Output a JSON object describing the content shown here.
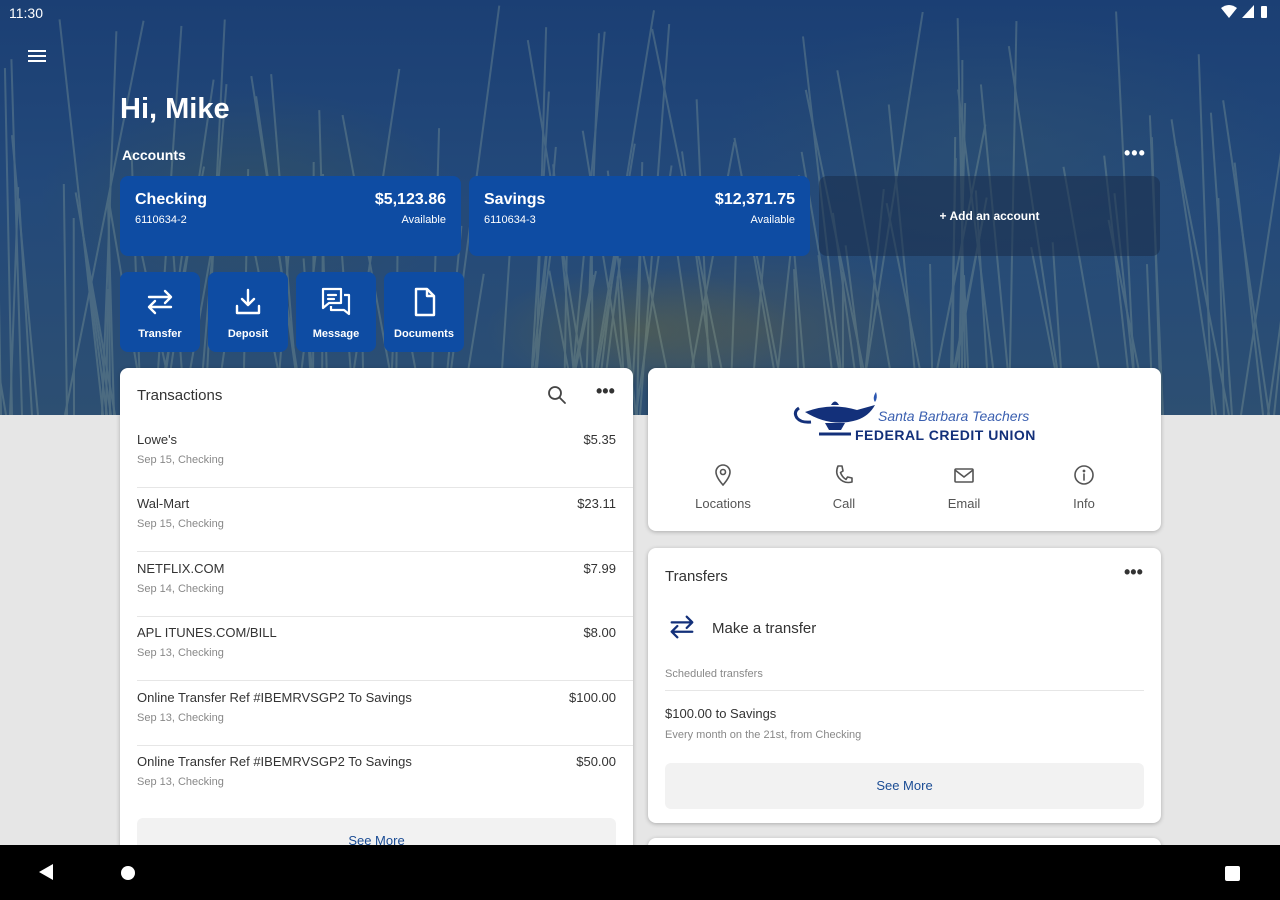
{
  "status_bar": {
    "time": "11:30"
  },
  "header": {
    "greeting": "Hi, Mike",
    "accounts_label": "Accounts",
    "more_label": "•••"
  },
  "accounts": [
    {
      "name": "Checking",
      "number": "6110634-2",
      "balance": "$5,123.86",
      "balance_label": "Available"
    },
    {
      "name": "Savings",
      "number": "6110634-3",
      "balance": "$12,371.75",
      "balance_label": "Available"
    }
  ],
  "add_account_label": "+ Add an account",
  "quick_actions": [
    {
      "label": "Transfer",
      "icon": "transfer-icon"
    },
    {
      "label": "Deposit",
      "icon": "deposit-icon"
    },
    {
      "label": "Message",
      "icon": "message-icon"
    },
    {
      "label": "Documents",
      "icon": "document-icon"
    }
  ],
  "transactions": {
    "title": "Transactions",
    "more_label": "•••",
    "items": [
      {
        "merchant": "Lowe's",
        "detail": "Sep 15, Checking",
        "amount": "$5.35"
      },
      {
        "merchant": "Wal-Mart",
        "detail": "Sep 15, Checking",
        "amount": "$23.11"
      },
      {
        "merchant": "NETFLIX.COM",
        "detail": "Sep 14, Checking",
        "amount": "$7.99"
      },
      {
        "merchant": "APL ITUNES.COM/BILL",
        "detail": "Sep 13, Checking",
        "amount": "$8.00"
      },
      {
        "merchant": "Online Transfer Ref #IBEMRVSGP2 To Savings",
        "detail": "Sep 13, Checking",
        "amount": "$100.00"
      },
      {
        "merchant": "Online Transfer Ref #IBEMRVSGP2 To Savings",
        "detail": "Sep 13, Checking",
        "amount": "$50.00"
      }
    ],
    "see_more": "See More"
  },
  "credit_union": {
    "name_script": "Santa Barbara Teachers",
    "name_bold": "FEDERAL CREDIT UNION",
    "contacts": [
      {
        "label": "Locations",
        "icon": "location-pin-icon"
      },
      {
        "label": "Call",
        "icon": "phone-icon"
      },
      {
        "label": "Email",
        "icon": "email-icon"
      },
      {
        "label": "Info",
        "icon": "info-icon"
      }
    ]
  },
  "transfers": {
    "title": "Transfers",
    "more_label": "•••",
    "make_transfer": "Make a transfer",
    "scheduled_label": "Scheduled transfers",
    "scheduled": [
      {
        "title": "$100.00 to Savings",
        "detail": "Every month on the 21st, from Checking"
      }
    ],
    "see_more": "See More"
  },
  "colors": {
    "primary": "#0e4ca3",
    "link": "#1b4c94",
    "hero_bg": "#1f4475",
    "page_bg": "#e6e6e6"
  }
}
